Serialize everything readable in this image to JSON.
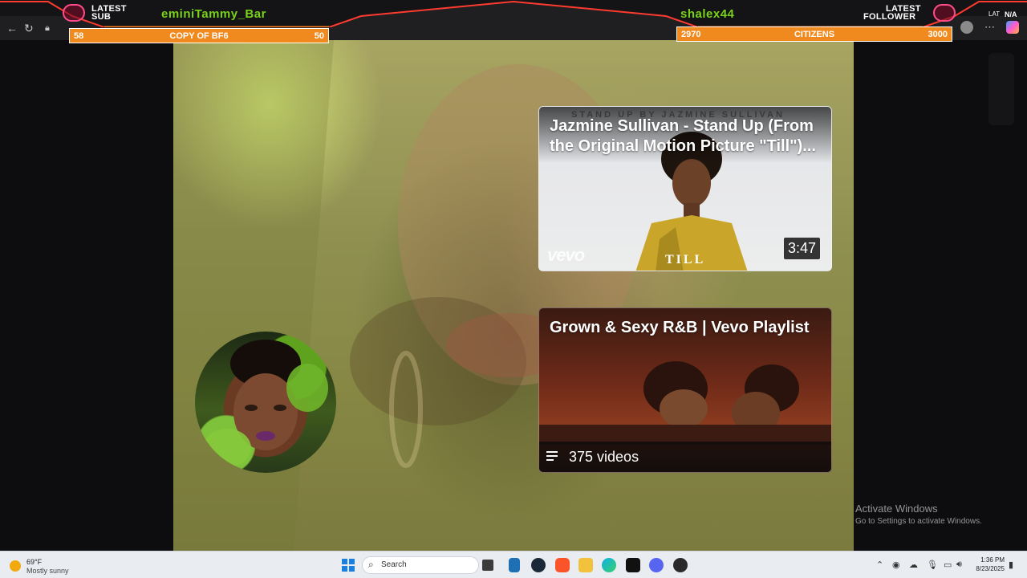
{
  "overlay": {
    "latest_sub_label_1": "LATEST",
    "latest_sub_label_2": "SUB",
    "latest_sub_name": "eminiTammy_Bar",
    "latest_follower_label_1": "LATEST",
    "latest_follower_label_2": "FOLLOWER",
    "latest_follower_name": "shalex44",
    "na_text": "N/A",
    "lat_text": "LAT",
    "goal_left": {
      "current": "58",
      "title": "COPY OF BF6",
      "target": "50",
      "fill": 1.0
    },
    "goal_right": {
      "current": "2970",
      "title": "CITIZENS",
      "target": "3000",
      "fill": 0.99
    },
    "colors": {
      "accent": "#f08a1f",
      "name_green": "#7ad21a",
      "border_red": "#ff3b2f"
    }
  },
  "cards": [
    {
      "top_line": "STAND UP   BY   JAZMINE SULLIVAN",
      "title": "Jazmine Sullivan - Stand Up (From the Original Motion Picture \"Till\")...",
      "duration": "3:47",
      "logo": "vevo",
      "film_title": "TILL"
    },
    {
      "title": "Grown & Sexy R&B | Vevo Playlist",
      "video_count": "375 videos"
    }
  ],
  "windows_watermark": {
    "line1": "Activate Windows",
    "line2": "Go to Settings to activate Windows."
  },
  "taskbar": {
    "weather_temp": "69°F",
    "weather_desc": "Mostly sunny",
    "search_placeholder": "Search",
    "time": "1:36 PM",
    "date": "8/23/2025"
  }
}
